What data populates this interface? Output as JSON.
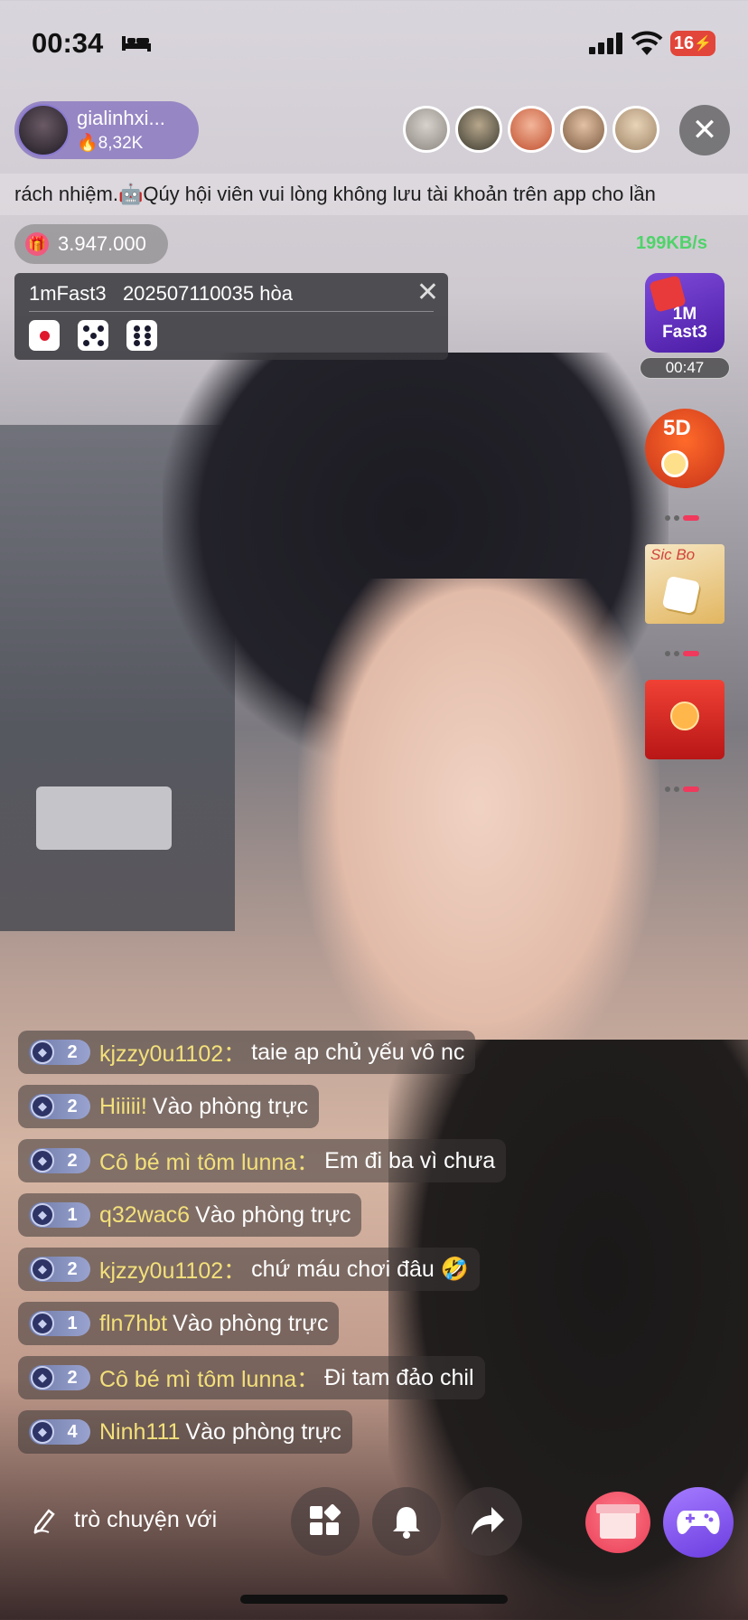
{
  "status_bar": {
    "time": "00:34",
    "battery": "16"
  },
  "host": {
    "name": "gialinhxi...",
    "fans": "8,32K"
  },
  "ticker": {
    "text": "rách nhiệm.🤖Qúy hội viên vui lòng không lưu tài khoản trên app cho lần"
  },
  "gift": {
    "count": "3.947.000"
  },
  "network": {
    "speed": "199KB/s"
  },
  "result_panel": {
    "game": "1mFast3",
    "round": "202507110035",
    "outcome": "hòa",
    "dice": [
      1,
      5,
      6
    ]
  },
  "games": {
    "fast3_label_1": "1M",
    "fast3_label_2": "Fast3",
    "fast3_timer": "00:47",
    "fived_label": "5D",
    "sicbo_label": "Sic Bo"
  },
  "chat": [
    {
      "level": "2",
      "user": "kjzzy0u1102：",
      "message": "taie ap chủ yếu vô nc"
    },
    {
      "level": "2",
      "user": "Hiiiii!",
      "message": "Vào phòng trực"
    },
    {
      "level": "2",
      "user": "Cô bé mì tôm lunna：",
      "message": "Em đi ba vì chưa"
    },
    {
      "level": "1",
      "user": "q32wac6",
      "message": "Vào phòng trực"
    },
    {
      "level": "2",
      "user": "kjzzy0u1102：",
      "message": "chứ máu chơi đâu 🤣"
    },
    {
      "level": "1",
      "user": "fln7hbt",
      "message": "Vào phòng trực"
    },
    {
      "level": "2",
      "user": "Cô bé mì tôm lunna：",
      "message": "Đi tam đảo chil"
    },
    {
      "level": "4",
      "user": "Ninh111",
      "message": "Vào phòng trực"
    }
  ],
  "bottom_bar": {
    "chat_placeholder": "trò chuyện với"
  },
  "colors": {
    "accent_pink": "#f0395c",
    "chat_username": "#f3e07a",
    "net_speed": "#4fd36a"
  }
}
